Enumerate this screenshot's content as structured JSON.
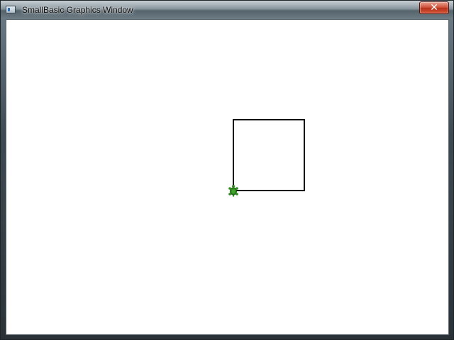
{
  "window": {
    "title": "SmallBasic Graphics Window",
    "close_glyph": "✕",
    "icon": "window-app-icon"
  },
  "canvas": {
    "background": "#ffffff",
    "drawing": {
      "shape": "square",
      "stroke": "#000000"
    },
    "turtle": {
      "icon": "turtle-icon",
      "color": "#2e8b1e"
    }
  }
}
